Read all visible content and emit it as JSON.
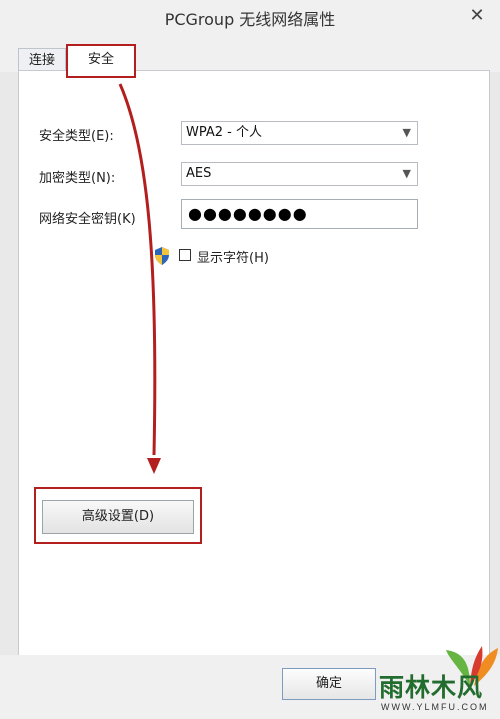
{
  "window": {
    "title": "PCGroup 无线网络属性",
    "close_label": "✕"
  },
  "tabs": [
    {
      "label": "连接",
      "active": false
    },
    {
      "label": "安全",
      "active": true
    }
  ],
  "form": {
    "security_type_label": "安全类型(E):",
    "security_type_value": "WPA2 - 个人",
    "encryption_type_label": "加密类型(N):",
    "encryption_type_value": "AES",
    "network_key_label": "网络安全密钥(K)",
    "network_key_value": "●●●●●●●●",
    "show_characters_label": "显示字符(H)",
    "show_characters_checked": false
  },
  "buttons": {
    "advanced_settings": "高级设置(D)",
    "ok": "确定"
  },
  "watermark": {
    "name": "雨林木风",
    "url": "WWW.YLMFU.COM"
  },
  "colors": {
    "annotation_red": "#b31f1f"
  }
}
